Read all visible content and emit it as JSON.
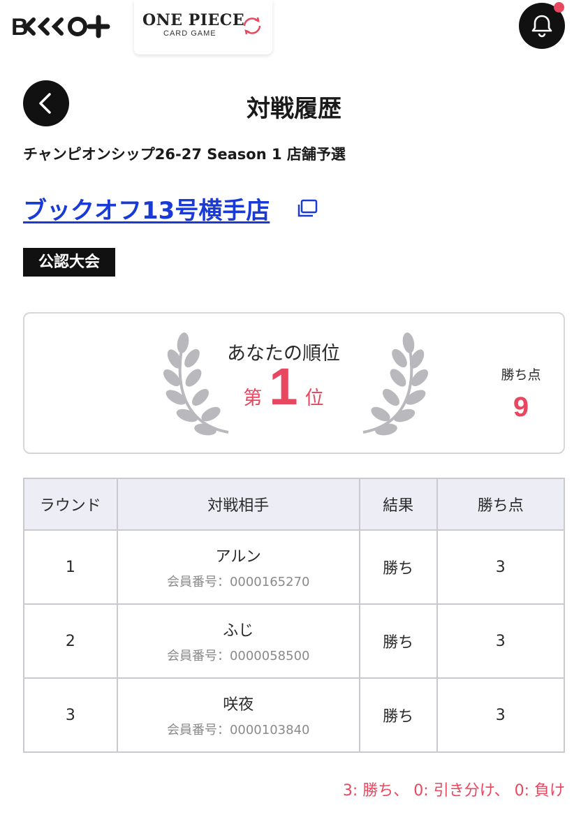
{
  "header": {
    "brand_logo_label": "B-CLUB+",
    "game_logo": {
      "title": "ONE PIECE",
      "subtitle": "CARD GAME"
    },
    "notification_has_unread": true
  },
  "page": {
    "title": "対戦履歴",
    "event_name": "チャンピオンシップ26-27 Season 1 店舗予選",
    "store_name": "ブックオフ13号横手店",
    "badge": "公認大会"
  },
  "ranking": {
    "label": "あなたの順位",
    "prefix": "第",
    "rank": "1",
    "suffix": "位",
    "points_label": "勝ち点",
    "points": "9"
  },
  "table": {
    "headers": {
      "round": "ラウンド",
      "opponent": "対戦相手",
      "result": "結果",
      "points": "勝ち点"
    },
    "member_label": "会員番号：",
    "rows": [
      {
        "round": "1",
        "opponent": "アルン",
        "member_id": "0000165270",
        "result": "勝ち",
        "points": "3"
      },
      {
        "round": "2",
        "opponent": "ふじ",
        "member_id": "0000058500",
        "result": "勝ち",
        "points": "3"
      },
      {
        "round": "3",
        "opponent": "咲夜",
        "member_id": "0000103840",
        "result": "勝ち",
        "points": "3"
      }
    ]
  },
  "legend": "3: 勝ち、 0: 引き分け、 0: 負け",
  "colors": {
    "accent": "#e8475f",
    "link": "#1a3ad6",
    "dark": "#111111",
    "header_bg": "#ededf6"
  }
}
